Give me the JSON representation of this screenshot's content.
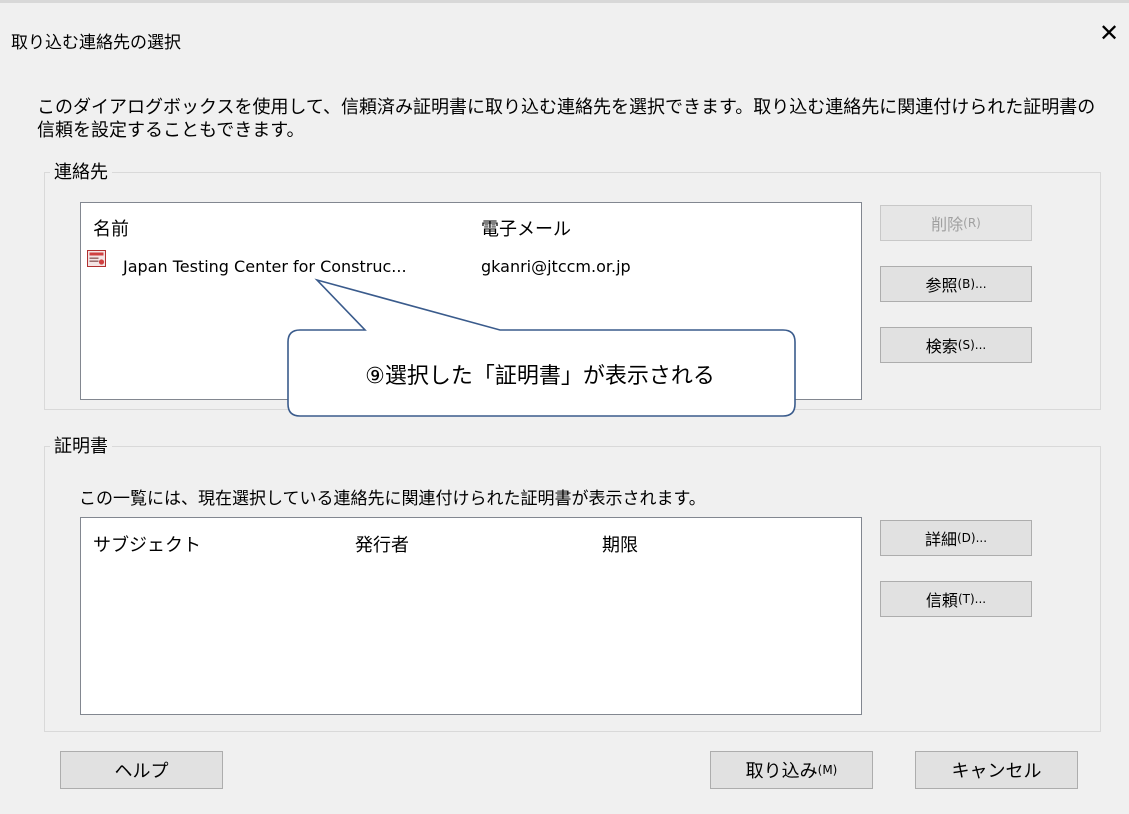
{
  "dialog": {
    "title": "取り込む連絡先の選択",
    "description": "このダイアログボックスを使用して、信頼済み証明書に取り込む連絡先を選択できます。取り込む連絡先に関連付けられた証明書の信頼を設定することもできます。"
  },
  "contacts": {
    "group_label": "連絡先",
    "columns": {
      "name": "名前",
      "email": "電子メール"
    },
    "rows": [
      {
        "name": "Japan Testing Center for Construc...",
        "email": "gkanri@jtccm.or.jp"
      }
    ],
    "buttons": {
      "delete": "削除",
      "delete_key": "(R)",
      "browse": "参照",
      "browse_key": "(B)...",
      "search": "検索",
      "search_key": "(S)..."
    }
  },
  "certificates": {
    "group_label": "証明書",
    "description": "この一覧には、現在選択している連絡先に関連付けられた証明書が表示されます。",
    "columns": {
      "subject": "サブジェクト",
      "issuer": "発行者",
      "expiry": "期限"
    },
    "buttons": {
      "details": "詳細",
      "details_key": "(D)...",
      "trust": "信頼",
      "trust_key": "(T)..."
    }
  },
  "footer": {
    "help": "ヘルプ",
    "import": "取り込み",
    "import_key": "(M)",
    "cancel": "キャンセル"
  },
  "annotation": {
    "callout": "⑨選択した「証明書」が表示される"
  },
  "colors": {
    "callout_border": "#3a5b8c",
    "listbox_border": "#828790"
  }
}
